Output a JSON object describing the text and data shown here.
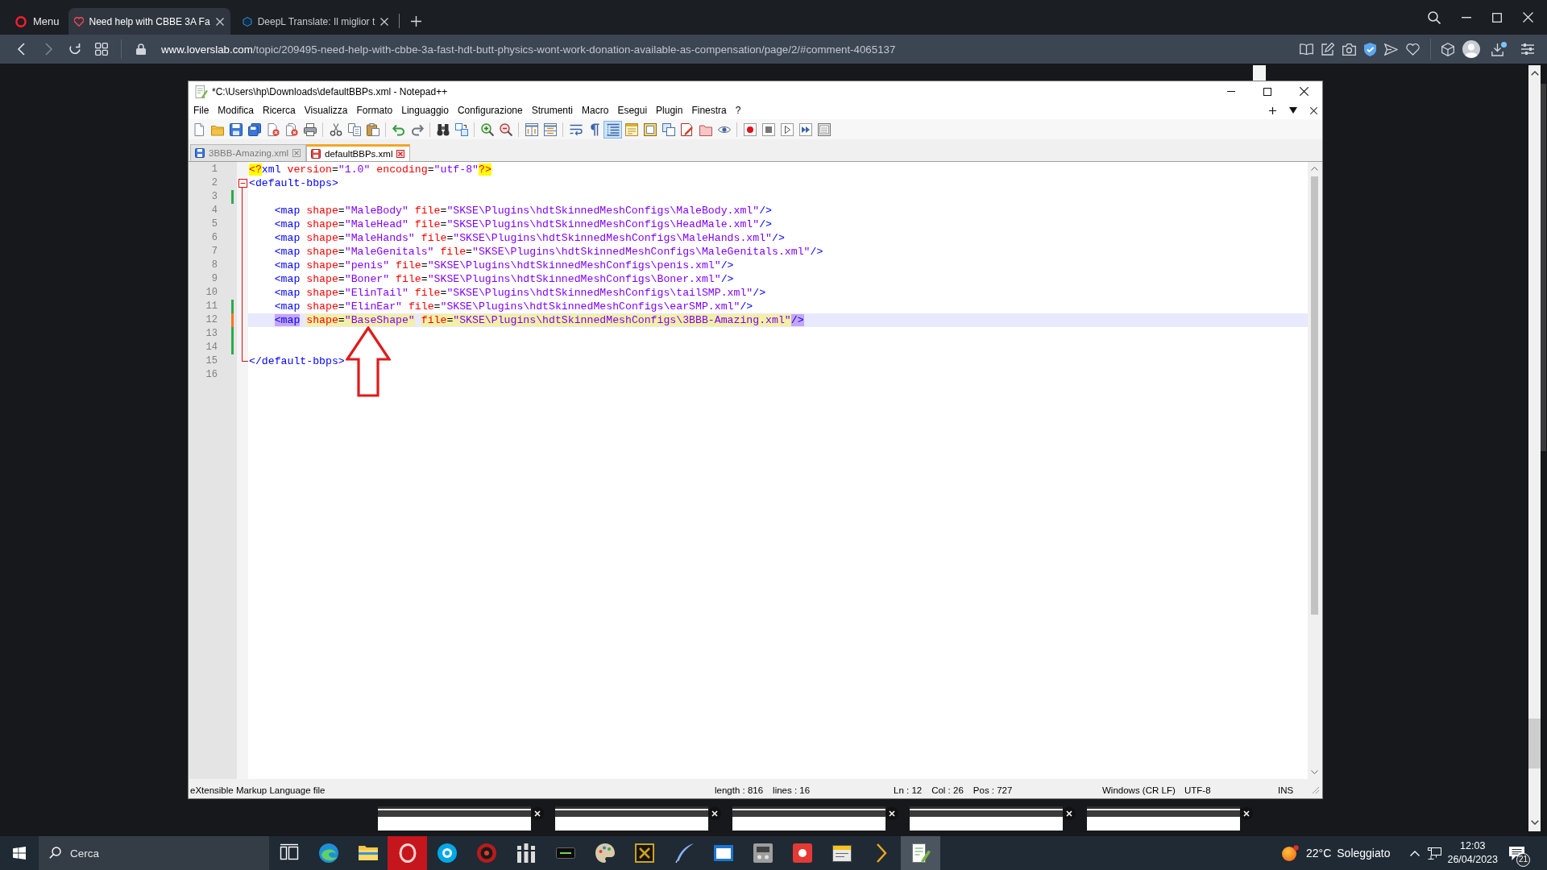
{
  "browser": {
    "menu_label": "Menu",
    "tabs": [
      {
        "title": "Need help with CBBE 3A Fa",
        "selected": true
      },
      {
        "title": "DeepL Translate: Il miglior t",
        "selected": false
      }
    ],
    "address": {
      "domain": "www.loverslab.com",
      "path": "/topic/209495-need-help-with-cbbe-3a-fast-hdt-butt-physics-wont-work-donation-available-as-compensation/page/2/#comment-4065137"
    }
  },
  "notepad": {
    "title": "*C:\\Users\\hp\\Downloads\\defaultBBPs.xml - Notepad++",
    "menu": [
      "File",
      "Modifica",
      "Ricerca",
      "Visualizza",
      "Formato",
      "Linguaggio",
      "Configurazione",
      "Strumenti",
      "Macro",
      "Esegui",
      "Plugin",
      "Finestra",
      "?"
    ],
    "toolbar": [
      [
        {
          "kind": "new",
          "on": false
        },
        {
          "kind": "open",
          "on": false
        },
        {
          "kind": "save",
          "on": false
        },
        {
          "kind": "saveall",
          "on": false
        },
        {
          "kind": "close",
          "on": false
        },
        {
          "kind": "closeall",
          "on": false
        },
        {
          "kind": "print",
          "on": false
        }
      ],
      [
        {
          "kind": "cut",
          "on": false
        },
        {
          "kind": "copy",
          "on": false
        },
        {
          "kind": "paste",
          "on": false
        }
      ],
      [
        {
          "kind": "undo",
          "on": false
        },
        {
          "kind": "redo",
          "on": false
        }
      ],
      [
        {
          "kind": "find",
          "on": false
        },
        {
          "kind": "replace",
          "on": false
        }
      ],
      [
        {
          "kind": "zoomin",
          "on": false
        },
        {
          "kind": "zoomout",
          "on": false
        }
      ],
      [
        {
          "kind": "syncv",
          "on": false
        },
        {
          "kind": "synch",
          "on": false
        }
      ],
      [
        {
          "kind": "wrap",
          "on": false
        },
        {
          "kind": "allchars",
          "on": false
        },
        {
          "kind": "indent",
          "on": true
        },
        {
          "kind": "udl",
          "on": false
        },
        {
          "kind": "docmap",
          "on": false
        },
        {
          "kind": "doclist",
          "on": false
        },
        {
          "kind": "funclist",
          "on": false
        },
        {
          "kind": "folder",
          "on": false
        },
        {
          "kind": "monitor",
          "on": false
        }
      ],
      [
        {
          "kind": "record",
          "on": false
        },
        {
          "kind": "stop",
          "on": false
        },
        {
          "kind": "play",
          "on": false
        },
        {
          "kind": "playmulti",
          "on": false
        },
        {
          "kind": "savemacro",
          "on": false
        }
      ]
    ],
    "tabs": [
      {
        "label": "3BBB-Amazing.xml",
        "selected": false,
        "modified": false
      },
      {
        "label": "defaultBBPs.xml",
        "selected": true,
        "modified": true
      }
    ],
    "lines": [
      {
        "number": "1",
        "current": false,
        "saved_change": false,
        "unsaved_change": false,
        "fold_start": false,
        "fold_end": false,
        "tokens": [
          {
            "kind": "pi",
            "text": "<?"
          },
          {
            "kind": "tag",
            "text": "xml"
          },
          {
            "kind": "attr",
            "text": " version"
          },
          {
            "kind": "plain",
            "text": "="
          },
          {
            "kind": "value",
            "text": "\"1.0\""
          },
          {
            "kind": "attr",
            "text": " encoding"
          },
          {
            "kind": "plain",
            "text": "="
          },
          {
            "kind": "value",
            "text": "\"utf-8\""
          },
          {
            "kind": "pi",
            "text": "?>"
          }
        ]
      },
      {
        "number": "2",
        "current": false,
        "saved_change": false,
        "unsaved_change": false,
        "fold_start": true,
        "fold_end": false,
        "tokens": [
          {
            "kind": "tag",
            "text": "<default-bbps>"
          }
        ]
      },
      {
        "number": "3",
        "current": false,
        "saved_change": true,
        "unsaved_change": false,
        "fold_start": false,
        "fold_end": false
      },
      {
        "number": "4",
        "current": false,
        "saved_change": false,
        "unsaved_change": false,
        "fold_start": false,
        "fold_end": false,
        "tokens": [
          {
            "kind": "tag",
            "text": "    <map"
          },
          {
            "kind": "attr",
            "text": " shape"
          },
          {
            "kind": "plain",
            "text": "="
          },
          {
            "kind": "value",
            "text": "\"MaleBody\""
          },
          {
            "kind": "attr",
            "text": " file"
          },
          {
            "kind": "plain",
            "text": "="
          },
          {
            "kind": "value",
            "text": "\"SKSE\\Plugins\\hdtSkinnedMeshConfigs\\MaleBody.xml\""
          },
          {
            "kind": "tag",
            "text": "/>"
          }
        ]
      },
      {
        "number": "5",
        "current": false,
        "saved_change": false,
        "unsaved_change": false,
        "fold_start": false,
        "fold_end": false,
        "tokens": [
          {
            "kind": "tag",
            "text": "    <map"
          },
          {
            "kind": "attr",
            "text": " shape"
          },
          {
            "kind": "plain",
            "text": "="
          },
          {
            "kind": "value",
            "text": "\"MaleHead\""
          },
          {
            "kind": "attr",
            "text": " file"
          },
          {
            "kind": "plain",
            "text": "="
          },
          {
            "kind": "value",
            "text": "\"SKSE\\Plugins\\hdtSkinnedMeshConfigs\\HeadMale.xml\""
          },
          {
            "kind": "tag",
            "text": "/>"
          }
        ]
      },
      {
        "number": "6",
        "current": false,
        "saved_change": false,
        "unsaved_change": false,
        "fold_start": false,
        "fold_end": false,
        "tokens": [
          {
            "kind": "tag",
            "text": "    <map"
          },
          {
            "kind": "attr",
            "text": " shape"
          },
          {
            "kind": "plain",
            "text": "="
          },
          {
            "kind": "value",
            "text": "\"MaleHands\""
          },
          {
            "kind": "attr",
            "text": " file"
          },
          {
            "kind": "plain",
            "text": "="
          },
          {
            "kind": "value",
            "text": "\"SKSE\\Plugins\\hdtSkinnedMeshConfigs\\MaleHands.xml\""
          },
          {
            "kind": "tag",
            "text": "/>"
          }
        ]
      },
      {
        "number": "7",
        "current": false,
        "saved_change": false,
        "unsaved_change": false,
        "fold_start": false,
        "fold_end": false,
        "tokens": [
          {
            "kind": "tag",
            "text": "    <map"
          },
          {
            "kind": "attr",
            "text": " shape"
          },
          {
            "kind": "plain",
            "text": "="
          },
          {
            "kind": "value",
            "text": "\"MaleGenitals\""
          },
          {
            "kind": "attr",
            "text": " file"
          },
          {
            "kind": "plain",
            "text": "="
          },
          {
            "kind": "value",
            "text": "\"SKSE\\Plugins\\hdtSkinnedMeshConfigs\\MaleGenitals.xml\""
          },
          {
            "kind": "tag",
            "text": "/>"
          }
        ]
      },
      {
        "number": "8",
        "current": false,
        "saved_change": false,
        "unsaved_change": false,
        "fold_start": false,
        "fold_end": false,
        "tokens": [
          {
            "kind": "tag",
            "text": "    <map"
          },
          {
            "kind": "attr",
            "text": " shape"
          },
          {
            "kind": "plain",
            "text": "="
          },
          {
            "kind": "value",
            "text": "\"penis\""
          },
          {
            "kind": "attr",
            "text": " file"
          },
          {
            "kind": "plain",
            "text": "="
          },
          {
            "kind": "value",
            "text": "\"SKSE\\Plugins\\hdtSkinnedMeshConfigs\\penis.xml\""
          },
          {
            "kind": "tag",
            "text": "/>"
          }
        ]
      },
      {
        "number": "9",
        "current": false,
        "saved_change": false,
        "unsaved_change": false,
        "fold_start": false,
        "fold_end": false,
        "tokens": [
          {
            "kind": "tag",
            "text": "    <map"
          },
          {
            "kind": "attr",
            "text": " shape"
          },
          {
            "kind": "plain",
            "text": "="
          },
          {
            "kind": "value",
            "text": "\"Boner\""
          },
          {
            "kind": "attr",
            "text": " file"
          },
          {
            "kind": "plain",
            "text": "="
          },
          {
            "kind": "value",
            "text": "\"SKSE\\Plugins\\hdtSkinnedMeshConfigs\\Boner.xml\""
          },
          {
            "kind": "tag",
            "text": "/>"
          }
        ]
      },
      {
        "number": "10",
        "current": false,
        "saved_change": false,
        "unsaved_change": false,
        "fold_start": false,
        "fold_end": false,
        "tokens": [
          {
            "kind": "tag",
            "text": "    <map"
          },
          {
            "kind": "attr",
            "text": " shape"
          },
          {
            "kind": "plain",
            "text": "="
          },
          {
            "kind": "value",
            "text": "\"ElinTail\""
          },
          {
            "kind": "attr",
            "text": " file"
          },
          {
            "kind": "plain",
            "text": "="
          },
          {
            "kind": "value",
            "text": "\"SKSE\\Plugins\\hdtSkinnedMeshConfigs\\tailSMP.xml\""
          },
          {
            "kind": "tag",
            "text": "/>"
          }
        ]
      },
      {
        "number": "11",
        "current": false,
        "saved_change": true,
        "unsaved_change": false,
        "fold_start": false,
        "fold_end": false,
        "tokens": [
          {
            "kind": "tag",
            "text": "    <map"
          },
          {
            "kind": "attr",
            "text": " shape"
          },
          {
            "kind": "plain",
            "text": "="
          },
          {
            "kind": "value",
            "text": "\"ElinEar\""
          },
          {
            "kind": "attr",
            "text": " file"
          },
          {
            "kind": "plain",
            "text": "="
          },
          {
            "kind": "value",
            "text": "\"SKSE\\Plugins\\hdtSkinnedMeshConfigs\\earSMP.xml\""
          },
          {
            "kind": "tag",
            "text": "/>"
          }
        ]
      },
      {
        "number": "12",
        "current": true,
        "saved_change": false,
        "unsaved_change": true,
        "fold_start": false,
        "fold_end": false,
        "tokens": [
          {
            "kind": "tagmatch",
            "text": "    <map"
          },
          {
            "kind": "attrmatch",
            "text": " shape"
          },
          {
            "kind": "plainmatch",
            "text": "="
          },
          {
            "kind": "valuematch",
            "text": "\"BaseShape\""
          },
          {
            "kind": "attrmatch",
            "text": " file"
          },
          {
            "kind": "plainmatch",
            "text": "="
          },
          {
            "kind": "valuematch",
            "text": "\"SKSE\\Plugins\\hdtSkinnedMeshConfigs\\3BBB-Amazing.xml\""
          },
          {
            "kind": "tagmatch",
            "text": "/>"
          }
        ]
      },
      {
        "number": "13",
        "current": false,
        "saved_change": true,
        "unsaved_change": false,
        "fold_start": false,
        "fold_end": false
      },
      {
        "number": "14",
        "current": false,
        "saved_change": true,
        "unsaved_change": false,
        "fold_start": false,
        "fold_end": false
      },
      {
        "number": "15",
        "current": false,
        "saved_change": false,
        "unsaved_change": false,
        "fold_start": false,
        "fold_end": true,
        "tokens": [
          {
            "kind": "tag",
            "text": "</default-bbps>"
          }
        ]
      },
      {
        "number": "16",
        "current": false,
        "saved_change": false,
        "unsaved_change": false,
        "fold_start": false,
        "fold_end": false
      }
    ],
    "status_bar": [
      [
        "eXtensible Markup Language file"
      ],
      [
        "length : 816",
        "lines : 16"
      ],
      [
        "Ln : 12",
        "Col : 26",
        "Pos : 727"
      ],
      [
        "Windows (CR LF)"
      ],
      [
        "UTF-8"
      ],
      [
        "INS"
      ]
    ]
  },
  "taskbar": {
    "search": {
      "placeholder": "Cerca"
    },
    "apps": [
      {
        "kind": "taskview",
        "selected": false,
        "flashing": false
      },
      {
        "kind": "swirl",
        "selected": false,
        "flashing": false
      },
      {
        "kind": "folder",
        "selected": false,
        "flashing": false
      },
      {
        "kind": "ring",
        "selected": false,
        "flashing": true
      },
      {
        "kind": "bubble",
        "selected": false,
        "flashing": false
      },
      {
        "kind": "target",
        "selected": false,
        "flashing": false
      },
      {
        "kind": "bars",
        "selected": false,
        "flashing": false
      },
      {
        "kind": "tile",
        "selected": false,
        "flashing": false
      },
      {
        "kind": "palette",
        "selected": false,
        "flashing": false
      },
      {
        "kind": "emblem",
        "selected": false,
        "flashing": false
      },
      {
        "kind": "quill",
        "selected": false,
        "flashing": false
      },
      {
        "kind": "window",
        "selected": false,
        "flashing": false
      },
      {
        "kind": "cabinet",
        "selected": false,
        "flashing": false
      },
      {
        "kind": "apptile",
        "selected": false,
        "flashing": false
      },
      {
        "kind": "notebook",
        "selected": false,
        "flashing": false
      },
      {
        "kind": "chevron",
        "selected": false,
        "flashing": false
      },
      {
        "kind": "notepad",
        "selected": true,
        "flashing": false
      }
    ],
    "weather": {
      "temperature": "22°C",
      "condition": "Soleggiato"
    },
    "clock": {
      "time": "12:03",
      "date": "26/04/2023"
    },
    "notifications": "21"
  }
}
